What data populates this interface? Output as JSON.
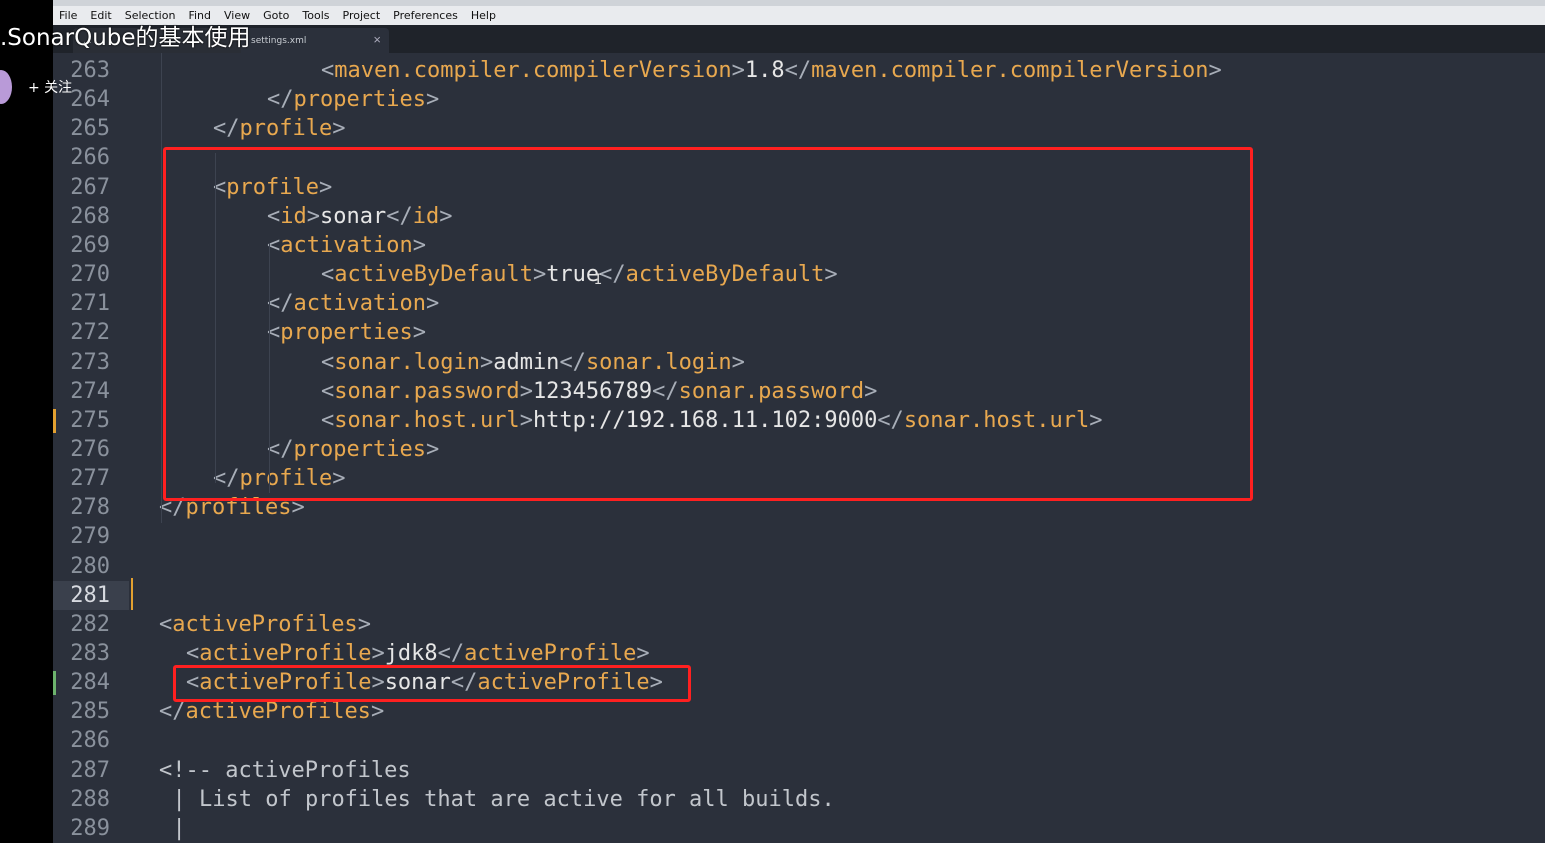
{
  "overlay": {
    "video_title": ".SonarQube的基本使用",
    "follow_label": "+ 关注"
  },
  "menu": [
    "File",
    "Edit",
    "Selection",
    "Find",
    "View",
    "Goto",
    "Tools",
    "Project",
    "Preferences",
    "Help"
  ],
  "tabs": [
    {
      "label": "...",
      "active": false
    },
    {
      "label": "settings.xml",
      "active": true
    }
  ],
  "tab_close_glyph": "×",
  "lines": [
    {
      "n": "263",
      "parts": [
        [
          "b",
          "<"
        ],
        [
          "t",
          "maven.compiler.compilerVersion"
        ],
        [
          "b",
          ">"
        ],
        [
          "v",
          "1.8"
        ],
        [
          "b",
          "</"
        ],
        [
          "t",
          "maven.compiler.compilerVersion"
        ],
        [
          "b",
          ">"
        ]
      ],
      "indent": 3
    },
    {
      "n": "264",
      "parts": [
        [
          "b",
          "</"
        ],
        [
          "t",
          "properties"
        ],
        [
          "b",
          ">"
        ]
      ],
      "indent": 2
    },
    {
      "n": "265",
      "parts": [
        [
          "b",
          "</"
        ],
        [
          "t",
          "profile"
        ],
        [
          "b",
          ">"
        ]
      ],
      "indent": 1
    },
    {
      "n": "266",
      "parts": [],
      "indent": 0
    },
    {
      "n": "267",
      "parts": [
        [
          "b",
          "<"
        ],
        [
          "t",
          "profile"
        ],
        [
          "b",
          ">"
        ]
      ],
      "indent": 1
    },
    {
      "n": "268",
      "parts": [
        [
          "b",
          "<"
        ],
        [
          "t",
          "id"
        ],
        [
          "b",
          ">"
        ],
        [
          "v",
          "sonar"
        ],
        [
          "b",
          "</"
        ],
        [
          "t",
          "id"
        ],
        [
          "b",
          ">"
        ]
      ],
      "indent": 2
    },
    {
      "n": "269",
      "parts": [
        [
          "b",
          "<"
        ],
        [
          "t",
          "activation"
        ],
        [
          "b",
          ">"
        ]
      ],
      "indent": 2
    },
    {
      "n": "270",
      "parts": [
        [
          "b",
          "<"
        ],
        [
          "t",
          "activeByDefault"
        ],
        [
          "b",
          ">"
        ],
        [
          "v",
          "true"
        ],
        [
          "b",
          "</"
        ],
        [
          "t",
          "activeByDefault"
        ],
        [
          "b",
          ">"
        ]
      ],
      "indent": 3
    },
    {
      "n": "271",
      "parts": [
        [
          "b",
          "</"
        ],
        [
          "t",
          "activation"
        ],
        [
          "b",
          ">"
        ]
      ],
      "indent": 2
    },
    {
      "n": "272",
      "parts": [
        [
          "b",
          "<"
        ],
        [
          "t",
          "properties"
        ],
        [
          "b",
          ">"
        ]
      ],
      "indent": 2
    },
    {
      "n": "273",
      "parts": [
        [
          "b",
          "<"
        ],
        [
          "t",
          "sonar.login"
        ],
        [
          "b",
          ">"
        ],
        [
          "v",
          "admin"
        ],
        [
          "b",
          "</"
        ],
        [
          "t",
          "sonar.login"
        ],
        [
          "b",
          ">"
        ]
      ],
      "indent": 3
    },
    {
      "n": "274",
      "parts": [
        [
          "b",
          "<"
        ],
        [
          "t",
          "sonar.password"
        ],
        [
          "b",
          ">"
        ],
        [
          "v",
          "123456789"
        ],
        [
          "b",
          "</"
        ],
        [
          "t",
          "sonar.password"
        ],
        [
          "b",
          ">"
        ]
      ],
      "indent": 3
    },
    {
      "n": "275",
      "parts": [
        [
          "b",
          "<"
        ],
        [
          "t",
          "sonar.host.url"
        ],
        [
          "b",
          ">"
        ],
        [
          "v",
          "http://192.168.11.102:9000"
        ],
        [
          "b",
          "</"
        ],
        [
          "t",
          "sonar.host.url"
        ],
        [
          "b",
          ">"
        ]
      ],
      "indent": 3
    },
    {
      "n": "276",
      "parts": [
        [
          "b",
          "</"
        ],
        [
          "t",
          "properties"
        ],
        [
          "b",
          ">"
        ]
      ],
      "indent": 2
    },
    {
      "n": "277",
      "parts": [
        [
          "b",
          "</"
        ],
        [
          "t",
          "profile"
        ],
        [
          "b",
          ">"
        ]
      ],
      "indent": 1
    },
    {
      "n": "278",
      "parts": [
        [
          "b",
          "</"
        ],
        [
          "t",
          "profiles"
        ],
        [
          "b",
          ">"
        ]
      ],
      "indent": 0
    },
    {
      "n": "279",
      "parts": [],
      "indent": 0
    },
    {
      "n": "280",
      "parts": [],
      "indent": 0
    },
    {
      "n": "281",
      "parts": [],
      "indent": 0,
      "current": true
    },
    {
      "n": "282",
      "parts": [
        [
          "b",
          "<"
        ],
        [
          "t",
          "activeProfiles"
        ],
        [
          "b",
          ">"
        ]
      ],
      "indent": 0
    },
    {
      "n": "283",
      "parts": [
        [
          "b",
          "<"
        ],
        [
          "t",
          "activeProfile"
        ],
        [
          "b",
          ">"
        ],
        [
          "v",
          "jdk8"
        ],
        [
          "b",
          "</"
        ],
        [
          "t",
          "activeProfile"
        ],
        [
          "b",
          ">"
        ]
      ],
      "indent": 0.5
    },
    {
      "n": "284",
      "parts": [
        [
          "b",
          "<"
        ],
        [
          "t",
          "activeProfile"
        ],
        [
          "b",
          ">"
        ],
        [
          "v",
          "sonar"
        ],
        [
          "b",
          "</"
        ],
        [
          "t",
          "activeProfile"
        ],
        [
          "b",
          ">"
        ]
      ],
      "indent": 0.5
    },
    {
      "n": "285",
      "parts": [
        [
          "b",
          "</"
        ],
        [
          "t",
          "activeProfiles"
        ],
        [
          "b",
          ">"
        ]
      ],
      "indent": 0
    },
    {
      "n": "286",
      "parts": [],
      "indent": 0
    },
    {
      "n": "287",
      "parts": [
        [
          "c",
          "<!-- activeProfiles"
        ]
      ],
      "indent": 0
    },
    {
      "n": "288",
      "parts": [
        [
          "c",
          "| List of profiles that are active for all builds."
        ]
      ],
      "indent": 0.25
    },
    {
      "n": "289",
      "parts": [
        [
          "c",
          "|"
        ]
      ],
      "indent": 0.25
    }
  ],
  "colors": {
    "background": "#2b303b",
    "tag": "#e8a84f",
    "bracket": "#a8aeb8",
    "value": "#e6e6e6",
    "comment": "#c2c6cc",
    "highlight_box": "#ff2020"
  }
}
